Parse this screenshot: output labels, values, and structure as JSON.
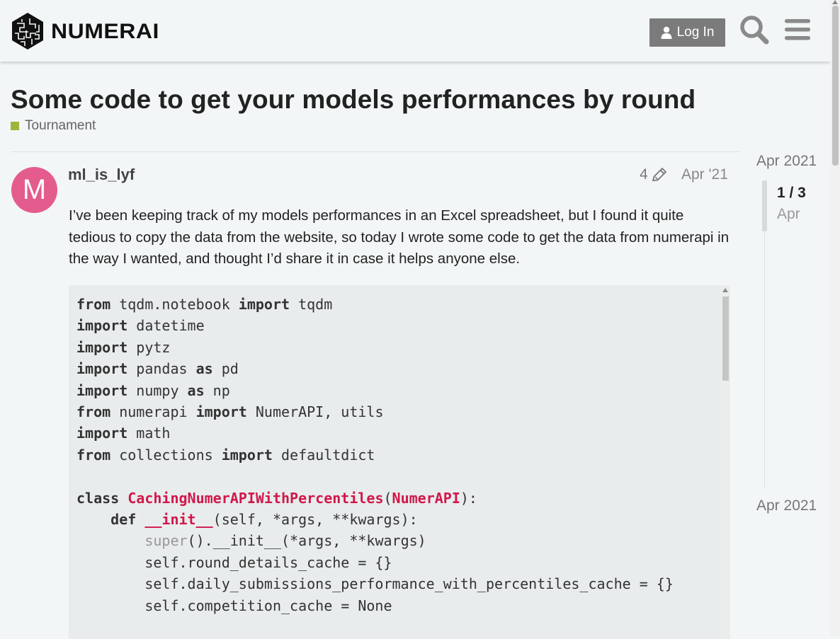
{
  "header": {
    "logo_text": "NUMERAI",
    "login_label": "Log In",
    "search_icon": "search-icon",
    "menu_icon": "hamburger-menu-icon"
  },
  "topic": {
    "title": "Some code to get your models performances by round",
    "category": "Tournament",
    "category_color": "#9cb53a"
  },
  "post": {
    "avatar_letter": "M",
    "avatar_color": "#e45b8e",
    "username": "ml_is_lyf",
    "edit_count": "4",
    "date": "Apr '21",
    "body": "I’ve been keeping track of my models performances in an Excel spreadsheet, but I found it quite tedious to copy the data from the website, so today I wrote some code to get the data from numerapi in the way I wanted, and thought I’d share it in case it helps anyone else.",
    "code_lines": [
      [
        {
          "t": "from",
          "k": "kw"
        },
        {
          "t": " tqdm.notebook "
        },
        {
          "t": "import",
          "k": "kw"
        },
        {
          "t": " tqdm"
        }
      ],
      [
        {
          "t": "import",
          "k": "kw"
        },
        {
          "t": " datetime"
        }
      ],
      [
        {
          "t": "import",
          "k": "kw"
        },
        {
          "t": " pytz"
        }
      ],
      [
        {
          "t": "import",
          "k": "kw"
        },
        {
          "t": " pandas "
        },
        {
          "t": "as",
          "k": "kw"
        },
        {
          "t": " pd"
        }
      ],
      [
        {
          "t": "import",
          "k": "kw"
        },
        {
          "t": " numpy "
        },
        {
          "t": "as",
          "k": "kw"
        },
        {
          "t": " np"
        }
      ],
      [
        {
          "t": "from",
          "k": "kw"
        },
        {
          "t": " numerapi "
        },
        {
          "t": "import",
          "k": "kw"
        },
        {
          "t": " NumerAPI, utils"
        }
      ],
      [
        {
          "t": "import",
          "k": "kw"
        },
        {
          "t": " math"
        }
      ],
      [
        {
          "t": "from",
          "k": "kw"
        },
        {
          "t": " collections "
        },
        {
          "t": "import",
          "k": "kw"
        },
        {
          "t": " defaultdict"
        }
      ],
      [],
      [
        {
          "t": "class",
          "k": "kw"
        },
        {
          "t": " "
        },
        {
          "t": "CachingNumerAPIWithPercentiles",
          "k": "nm"
        },
        {
          "t": "("
        },
        {
          "t": "NumerAPI",
          "k": "nm"
        },
        {
          "t": "):"
        }
      ],
      [
        {
          "t": "    "
        },
        {
          "t": "def",
          "k": "kw"
        },
        {
          "t": " "
        },
        {
          "t": "__init__",
          "k": "nm"
        },
        {
          "t": "(self, *args, **kwargs):"
        }
      ],
      [
        {
          "t": "        "
        },
        {
          "t": "super",
          "k": "bi"
        },
        {
          "t": "().__init__(*args, **kwargs)"
        }
      ],
      [
        {
          "t": "        self.round_details_cache = {}"
        }
      ],
      [
        {
          "t": "        self.daily_submissions_performance_with_percentiles_cache = {}"
        }
      ],
      [
        {
          "t": "        self.competition_cache = None"
        }
      ],
      [],
      []
    ]
  },
  "timeline": {
    "start_date": "Apr 2021",
    "position": "1 / 3",
    "position_date": "Apr",
    "end_date": "Apr 2021"
  }
}
